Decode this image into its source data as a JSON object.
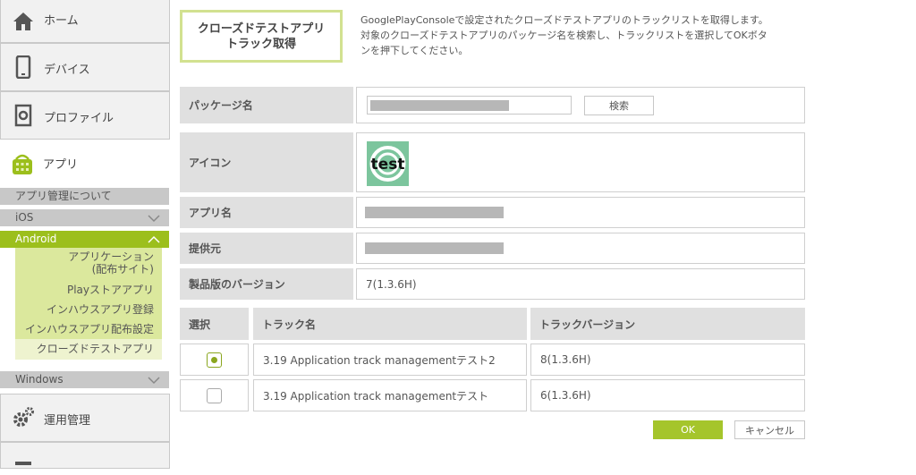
{
  "sidebar": {
    "home": {
      "label": "ホーム",
      "icon": "home-icon"
    },
    "device": {
      "label": "デバイス",
      "icon": "smartphone-icon"
    },
    "profile": {
      "label": "プロファイル",
      "icon": "profile-gear-icon"
    },
    "apps": {
      "label": "アプリ",
      "icon": "apps-icon"
    },
    "sub": {
      "about": "アプリ管理について",
      "ios": "iOS",
      "android": "Android",
      "windows": "Windows"
    },
    "android_menu": [
      {
        "label1": "アプリケーション",
        "label2": "(配布サイト)"
      },
      {
        "label1": "Playストアアプリ"
      },
      {
        "label1": "インハウスアプリ登録"
      },
      {
        "label1": "インハウスアプリ配布設定"
      },
      {
        "label1": "クローズドテストアプリ"
      }
    ],
    "ops": {
      "label": "運用管理",
      "icon": "gears-icon"
    }
  },
  "main": {
    "title_line1": "クローズドテストアプリ",
    "title_line2": "トラック取得",
    "desc_line1": "GooglePlayConsoleで設定されたクローズドテストアプリのトラックリストを取得します。",
    "desc_line2": "対象のクローズドテストアプリのパッケージ名を検索し、トラックリストを選択してOKボタ",
    "desc_line3": "ンを押下してください。",
    "fields": {
      "package_label": "パッケージ名",
      "search_button": "検索",
      "icon_label": "アイコン",
      "icon_text": "test",
      "app_name_label": "アプリ名",
      "vendor_label": "提供元",
      "version_label": "製品版のバージョン",
      "version_value": "7(1.3.6H)"
    },
    "table": {
      "headers": {
        "select": "選択",
        "track": "トラック名",
        "track_version": "トラックバージョン"
      },
      "rows": [
        {
          "track": "3.19 Application track managementテスト2",
          "version": "8(1.3.6H)",
          "selected": true
        },
        {
          "track": "3.19 Application track managementテスト",
          "version": "6(1.3.6H)",
          "selected": false
        }
      ]
    },
    "ok_button": "OK",
    "cancel_button": "キャンセル"
  },
  "colors": {
    "accent": "#9cbf1c",
    "accent_light": "#dbe89d",
    "panel": "#e0e0e0",
    "title_border": "#d2e190"
  }
}
